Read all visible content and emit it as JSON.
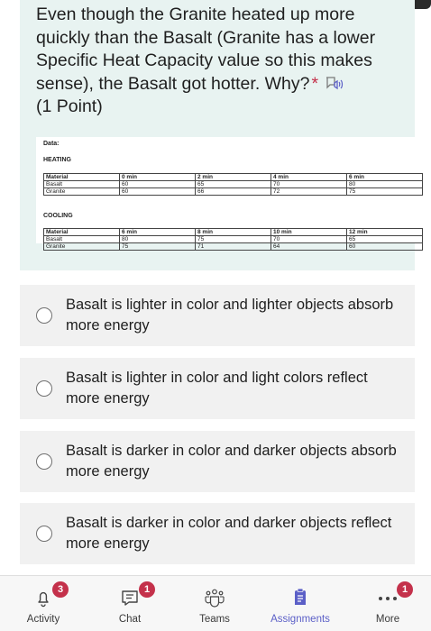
{
  "question": {
    "text": "Even though the Granite heated up more quickly than the Basalt (Granite has a lower Specific Heat Capacity value so this makes sense), the Basalt got hotter. Why?",
    "required_mark": "*",
    "points": "(1 Point)"
  },
  "data_image": {
    "data_label": "Data:",
    "heating_label": "HEATING",
    "heating_header": [
      "Material",
      "0 min",
      "2 min",
      "4 min",
      "6 min"
    ],
    "heating_rows": [
      [
        "Basalt",
        "60",
        "65",
        "70",
        "80"
      ],
      [
        "Granite",
        "60",
        "66",
        "72",
        "75"
      ]
    ],
    "cooling_label": "COOLING",
    "cooling_header": [
      "Material",
      "6 min",
      "8 min",
      "10 min",
      "12 min"
    ],
    "cooling_rows": [
      [
        "Basalt",
        "80",
        "75",
        "70",
        "65"
      ],
      [
        "Granite",
        "75",
        "71",
        "64",
        "60"
      ]
    ]
  },
  "options": [
    {
      "label": "Basalt is lighter in color and lighter objects absorb more energy"
    },
    {
      "label": "Basalt is lighter in color and light colors reflect more energy"
    },
    {
      "label": "Basalt is darker in color and darker objects absorb more energy"
    },
    {
      "label": "Basalt is darker in color and darker objects reflect more energy"
    }
  ],
  "nav": {
    "activity": {
      "label": "Activity",
      "badge": "3",
      "icon": "bell-icon"
    },
    "chat": {
      "label": "Chat",
      "badge": "1",
      "icon": "chat-icon"
    },
    "teams": {
      "label": "Teams",
      "icon": "teams-icon"
    },
    "assignments": {
      "label": "Assignments",
      "icon": "assignments-icon"
    },
    "more": {
      "label": "More",
      "badge": "1",
      "icon": "more-icon"
    }
  },
  "colors": {
    "question_bg": "#e8f3f1",
    "option_bg": "#f1f1f1",
    "accent": "#5b5fc7",
    "badge": "#c4314b"
  }
}
